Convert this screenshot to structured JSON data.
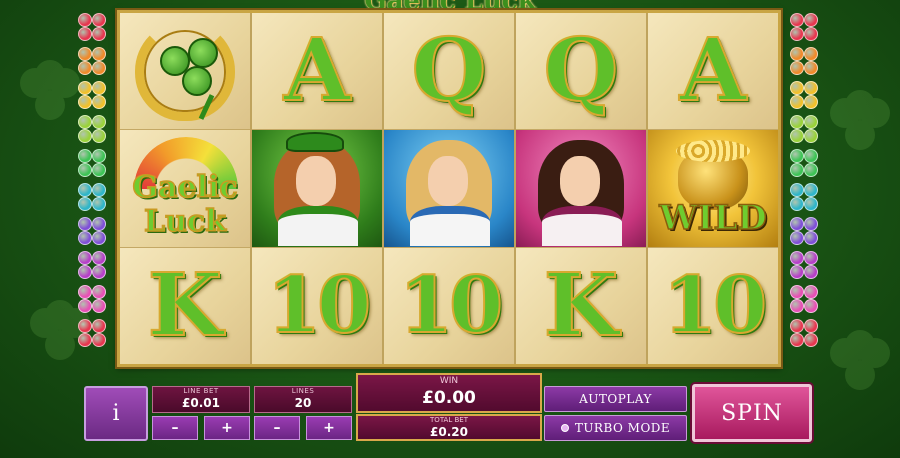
{
  "game": {
    "title": "Gaelic Luck",
    "logo": {
      "line1": "Gaelic",
      "line2": "Luck"
    },
    "wild_label": "WILD"
  },
  "reels": [
    [
      "horseshoe-clover",
      "gaelic-luck-logo",
      "K"
    ],
    [
      "A",
      "green-lady",
      "10"
    ],
    [
      "Q",
      "blue-lady",
      "10"
    ],
    [
      "Q",
      "pink-lady",
      "K"
    ],
    [
      "A",
      "wild-pot-of-gold",
      "10"
    ]
  ],
  "reel_letters": {
    "r1c3": "K",
    "r2c1": "A",
    "r2c3": "10",
    "r3c1": "Q",
    "r3c3": "10",
    "r4c1": "Q",
    "r4c3": "K",
    "r5c1": "A",
    "r5c3": "10"
  },
  "side_clover_colors": [
    "#e8364f",
    "#f08a2a",
    "#f2c02a",
    "#9ad23a",
    "#3ec456",
    "#2fb6c9",
    "#7f4fd8",
    "#b63fc8",
    "#e84fb5",
    "#e8364f"
  ],
  "controls": {
    "info_label": "i",
    "line_bet": {
      "label": "LINE BET",
      "value": "£0.01"
    },
    "lines": {
      "label": "LINES",
      "value": "20"
    },
    "minus_label": "–",
    "plus_label": "+",
    "win": {
      "label": "WIN",
      "value": "£0.00"
    },
    "total_bet": {
      "label": "TOTAL BET",
      "value": "£0.20"
    },
    "autoplay_label": "AUTOPLAY",
    "turbo_label": "TURBO MODE",
    "spin_label": "SPIN"
  },
  "colors": {
    "accent_purple": "#7b2f95",
    "accent_maroon": "#5e0d35",
    "spin_pink": "#c42c76",
    "symbol_green": "#5fbf2a",
    "frame_gold": "#c9a544"
  }
}
